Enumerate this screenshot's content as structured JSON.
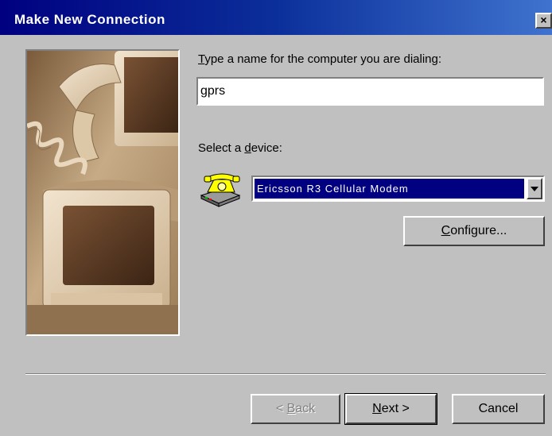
{
  "window": {
    "title": "Make New Connection",
    "close_glyph": "×"
  },
  "form": {
    "name_label": "Type a name for the computer you are dialing:",
    "name_mnemonic": "T",
    "name_label_rest": "ype a name for the computer you are dialing:",
    "name_value": "gprs",
    "device_label_prefix": "Select a ",
    "device_mnemonic": "d",
    "device_label_rest": "evice:",
    "device_value": "Ericsson R3 Cellular Modem",
    "device_icon": "telephone-modem-icon"
  },
  "buttons": {
    "configure_mnemonic": "C",
    "configure_rest": "onfigure...",
    "back_prefix": "< ",
    "back_mnemonic": "B",
    "back_rest": "ack",
    "next_mnemonic": "N",
    "next_rest": "ext >",
    "cancel": "Cancel"
  },
  "colors": {
    "titlebar_start": "#000080",
    "titlebar_end": "#3f73cf",
    "selection": "#000080",
    "face": "#c0c0c0"
  }
}
